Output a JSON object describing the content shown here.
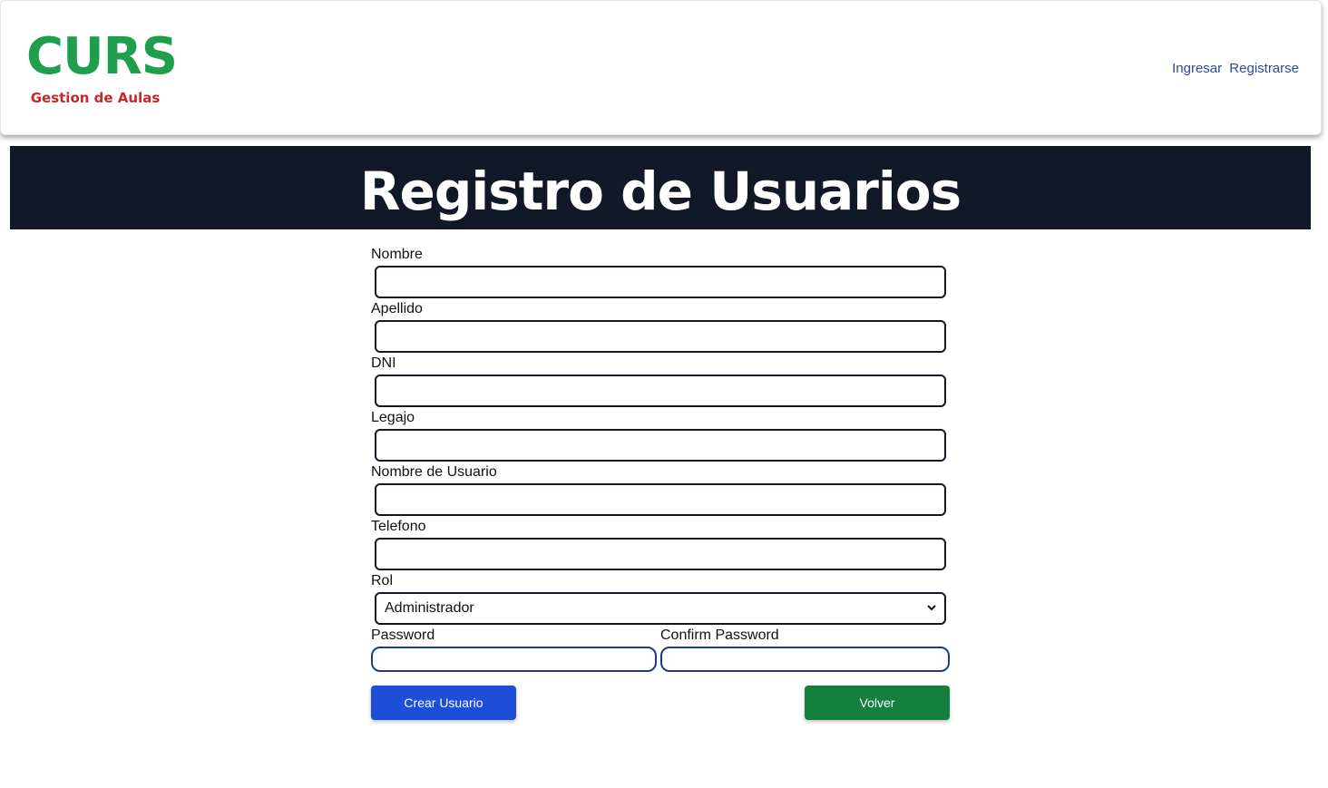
{
  "header": {
    "logo_title": "CURS",
    "logo_subtitle": "Gestion de Aulas",
    "nav_login": "Ingresar",
    "nav_register": "Registrarse"
  },
  "banner": {
    "title": "Registro de Usuarios"
  },
  "form": {
    "nombre_label": "Nombre",
    "nombre_value": "",
    "apellido_label": "Apellido",
    "apellido_value": "",
    "dni_label": "DNI",
    "dni_value": "",
    "legajo_label": "Legajo",
    "legajo_value": "",
    "usuario_label": "Nombre de Usuario",
    "usuario_value": "",
    "telefono_label": "Telefono",
    "telefono_value": "",
    "rol_label": "Rol",
    "rol_selected": "Administrador",
    "password_label": "Password",
    "password_value": "",
    "confirm_label": "Confirm Password",
    "confirm_value": "",
    "create_button": "Crear Usuario",
    "back_button": "Volver"
  },
  "colors": {
    "logo_green": "#1f9e4d",
    "logo_red": "#c62828",
    "banner_bg": "#111827",
    "create_blue": "#1d4ed8",
    "back_green": "#15803d",
    "link_blue": "#2a4aa0"
  }
}
